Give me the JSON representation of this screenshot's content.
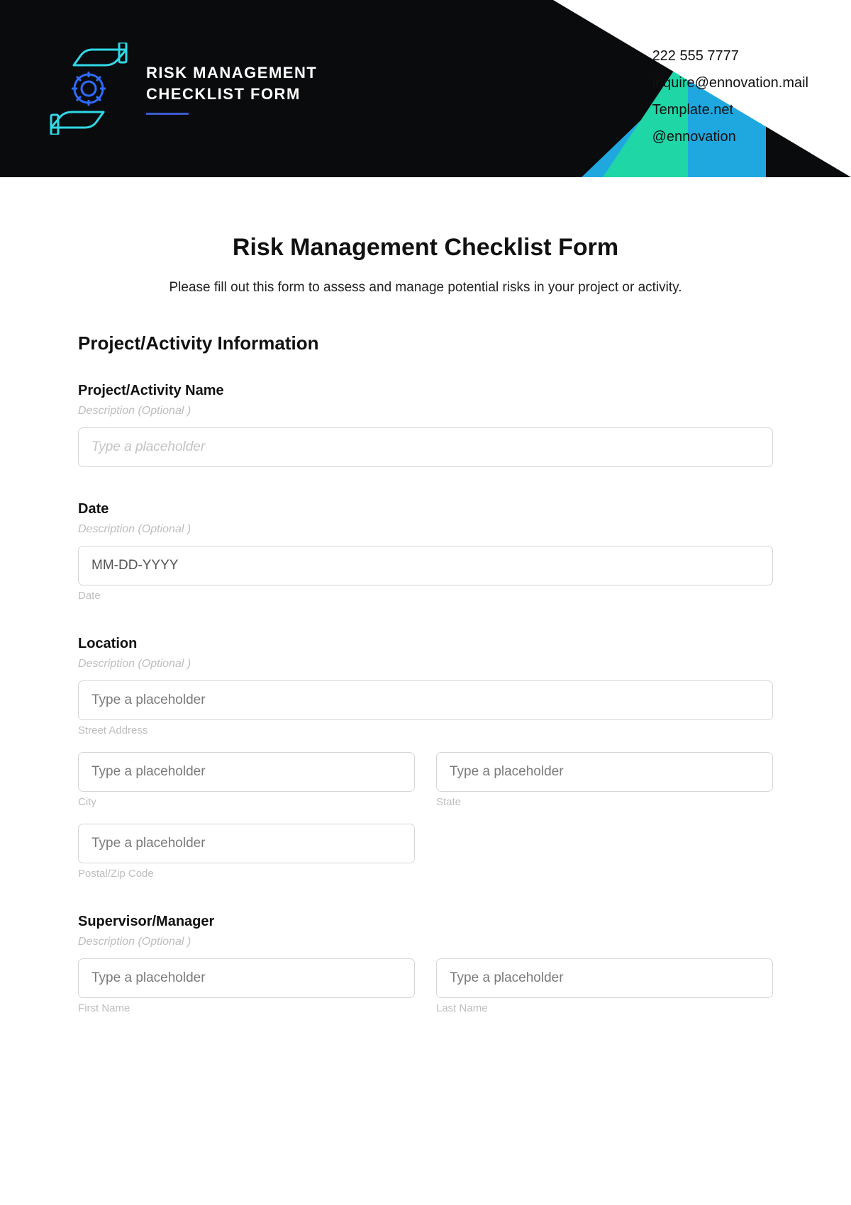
{
  "banner": {
    "title_line1": "RISK MANAGEMENT",
    "title_line2": "CHECKLIST FORM"
  },
  "contact": {
    "phone": "222 555 7777",
    "email": "inquire@ennovation.mail",
    "website": "Template.net",
    "handle": "@ennovation"
  },
  "main": {
    "heading": "Risk Management Checklist Form",
    "intro": "Please fill out this form to assess and manage potential risks in your project or activity."
  },
  "section1": {
    "heading": "Project/Activity Information"
  },
  "fields": {
    "name": {
      "label": "Project/Activity Name",
      "desc": "Description (Optional )",
      "placeholder": "Type a placeholder"
    },
    "date": {
      "label": "Date",
      "desc": "Description (Optional )",
      "placeholder": "MM-DD-YYYY",
      "sub": "Date"
    },
    "location": {
      "label": "Location",
      "desc": "Description (Optional )",
      "street_placeholder": "Type a placeholder",
      "street_sub": "Street Address",
      "city_placeholder": "Type a placeholder",
      "city_sub": "City",
      "state_placeholder": "Type a placeholder",
      "state_sub": "State",
      "postal_placeholder": "Type a placeholder",
      "postal_sub": "Postal/Zip Code"
    },
    "supervisor": {
      "label": "Supervisor/Manager",
      "desc": "Description (Optional )",
      "first_placeholder": "Type a placeholder",
      "first_sub": "First Name",
      "last_placeholder": "Type a placeholder",
      "last_sub": "Last Name"
    }
  }
}
